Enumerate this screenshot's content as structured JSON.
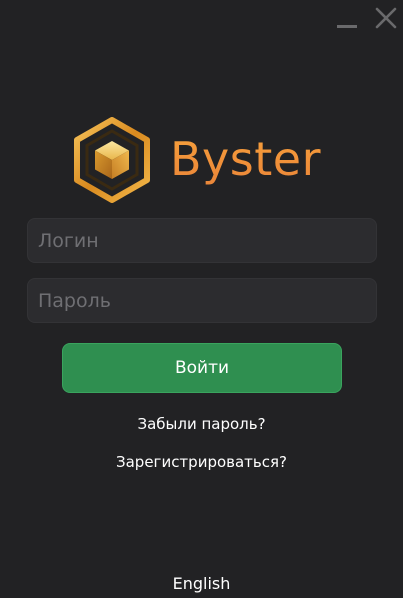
{
  "titlebar": {
    "minimize_icon": "minimize-icon",
    "close_icon": "close-icon"
  },
  "brand": {
    "name": "Byster",
    "logo_icon": "gold-hexagon-cube-icon",
    "accent_color": "#f0953a"
  },
  "form": {
    "login_placeholder": "Логин",
    "password_placeholder": "Пароль",
    "submit_label": "Войти",
    "submit_color": "#2f8f50"
  },
  "links": {
    "forgot_password": "Забыли пароль?",
    "register": "Зарегистрироваться?"
  },
  "footer": {
    "language": "English"
  }
}
